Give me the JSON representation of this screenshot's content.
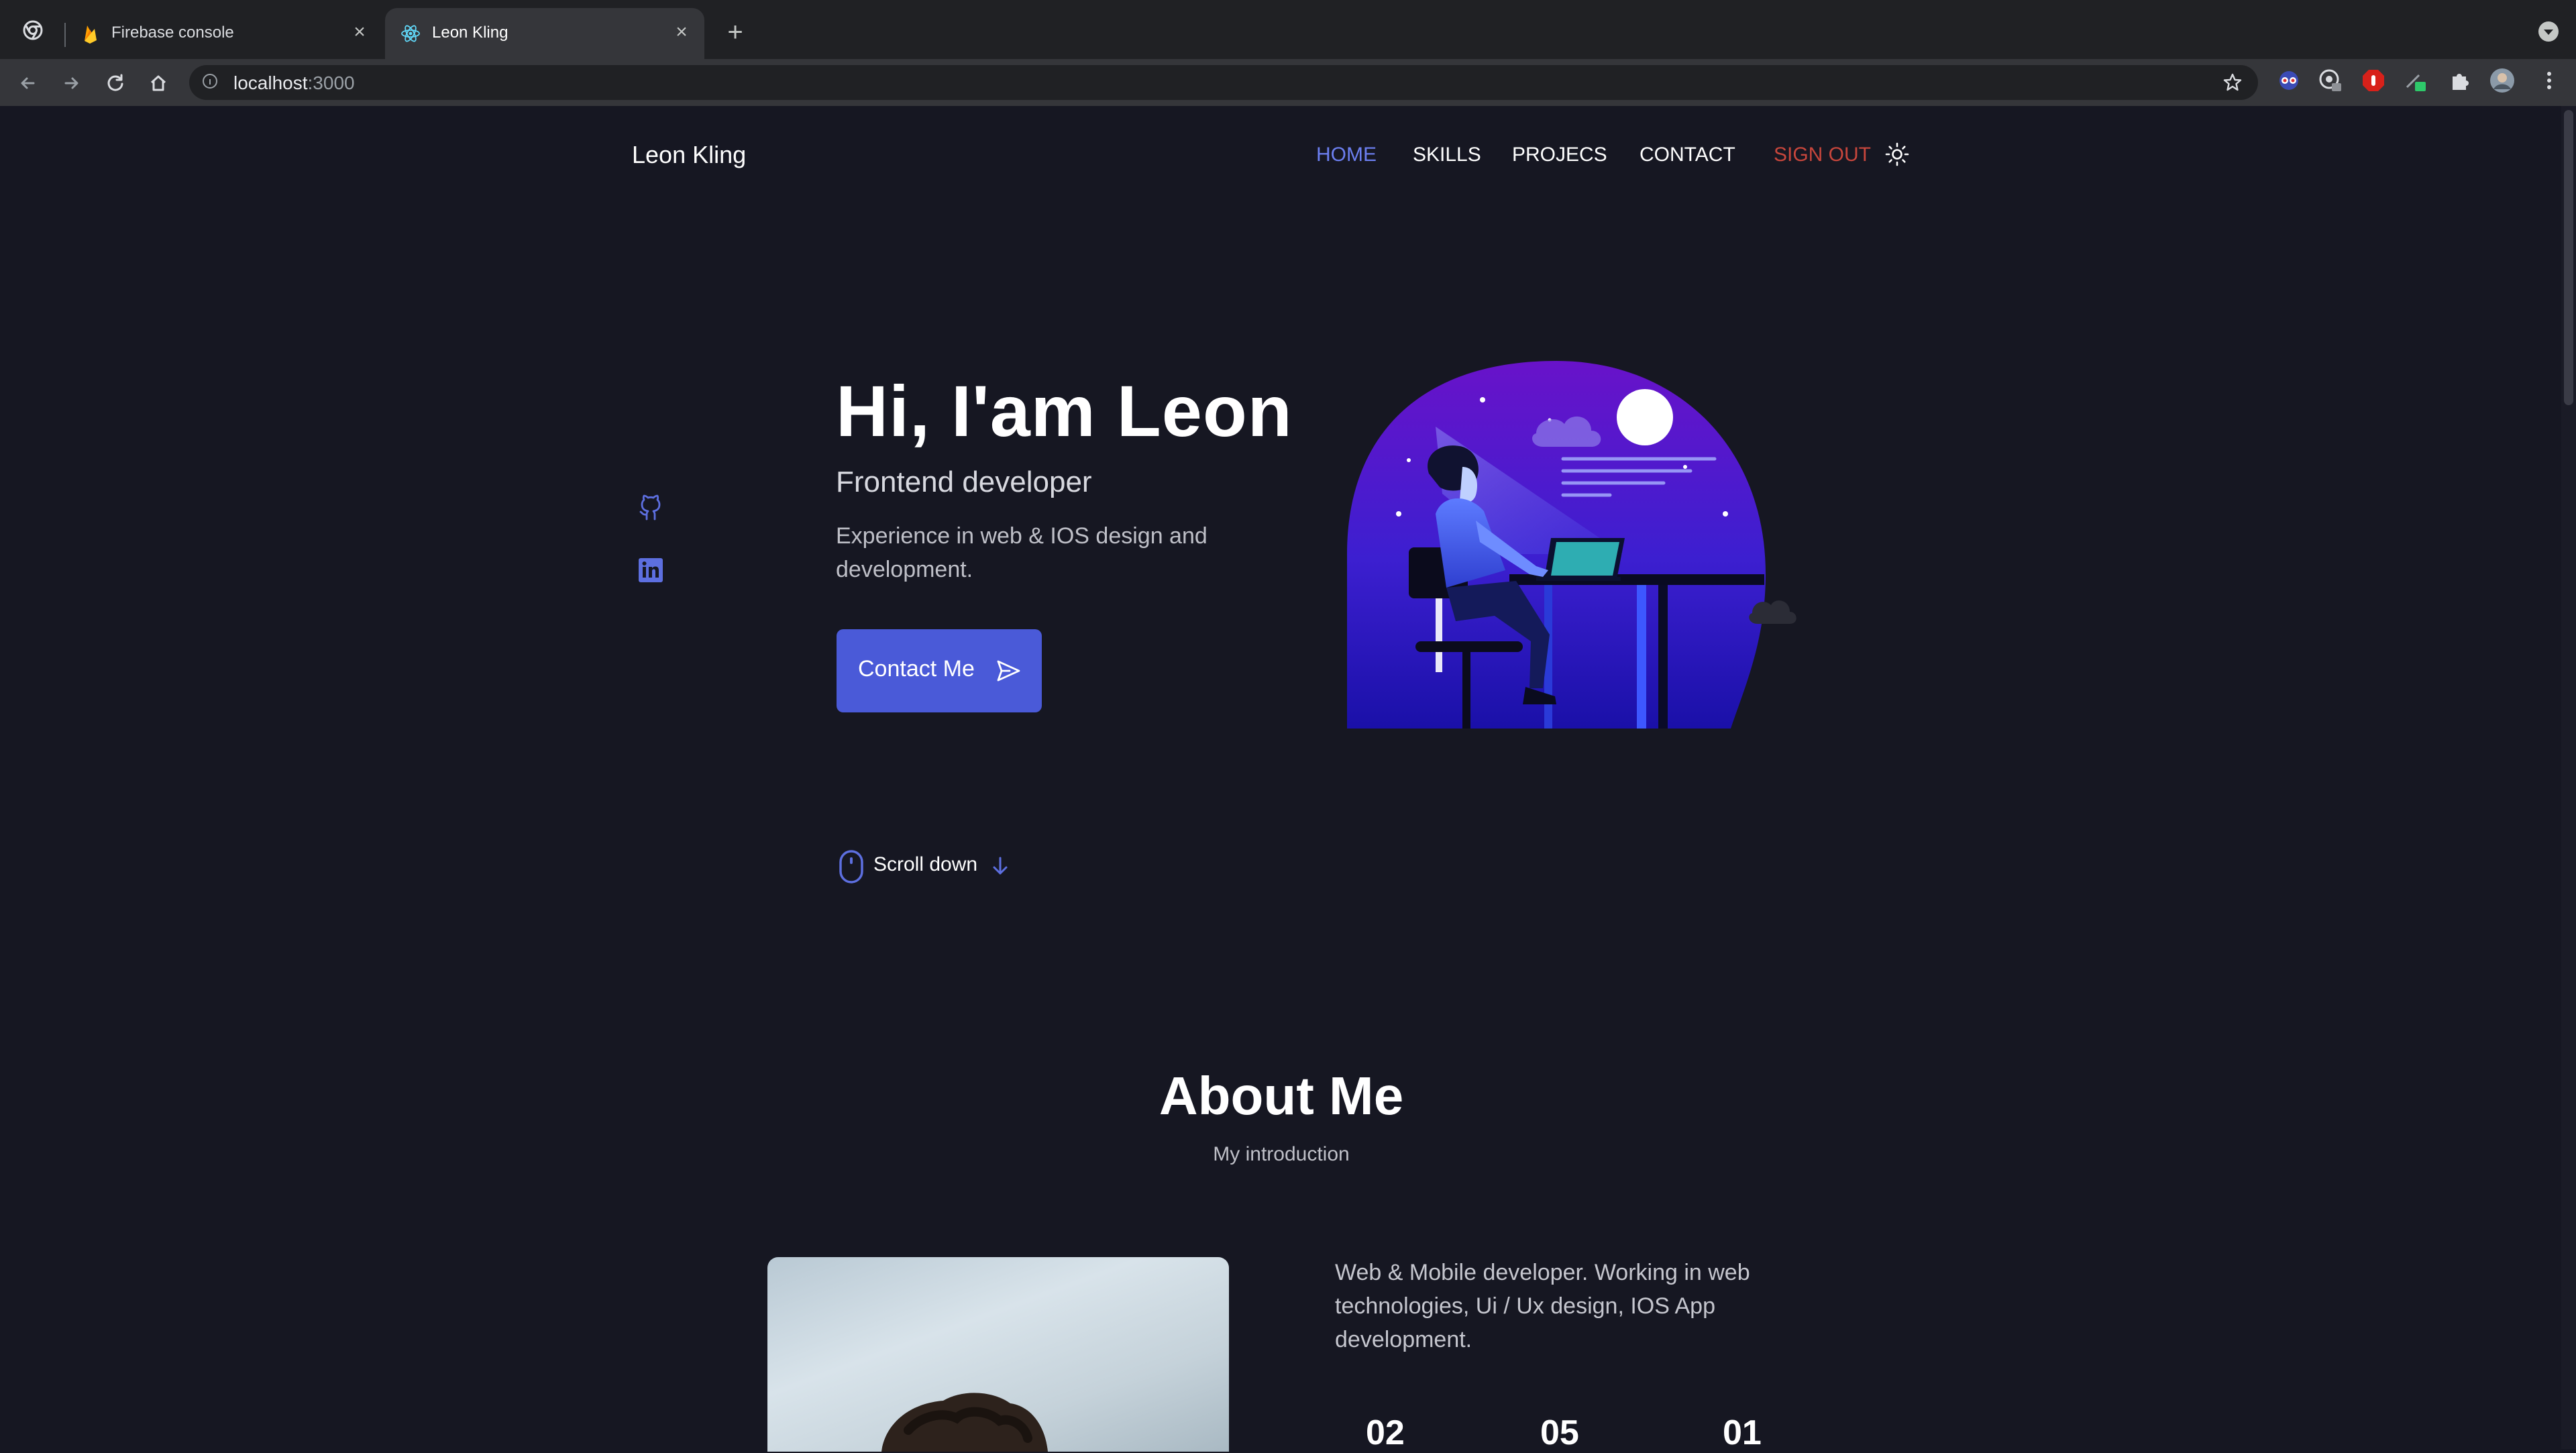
{
  "browser": {
    "tabs": [
      {
        "title": "Firebase console",
        "active": false
      },
      {
        "title": "Leon Kling",
        "active": true
      }
    ],
    "url_host": "localhost",
    "url_port": ":3000",
    "close_glyph": "×",
    "newtab_glyph": "+"
  },
  "nav": {
    "brand": "Leon Kling",
    "items": [
      "HOME",
      "SKILLS",
      "PROJECS",
      "CONTACT"
    ],
    "sign_out": "SIGN OUT",
    "active_item": "HOME",
    "accent_color": "#6c7ff0",
    "sign_out_color": "#c7463c"
  },
  "hero": {
    "title": "Hi, I'am Leon",
    "subtitle": "Frontend developer",
    "description": "Experience in web & IOS design and development.",
    "cta_label": "Contact Me",
    "cta_color": "#4a5ad8",
    "scroll_label": "Scroll down",
    "socials": [
      "github-icon",
      "linkedin-icon"
    ]
  },
  "about": {
    "title": "About Me",
    "subtitle": "My introduction",
    "description": "Web & Mobile developer. Working in web technologies, Ui / Ux design, IOS App development.",
    "stats": [
      "02",
      "05",
      "01"
    ]
  }
}
